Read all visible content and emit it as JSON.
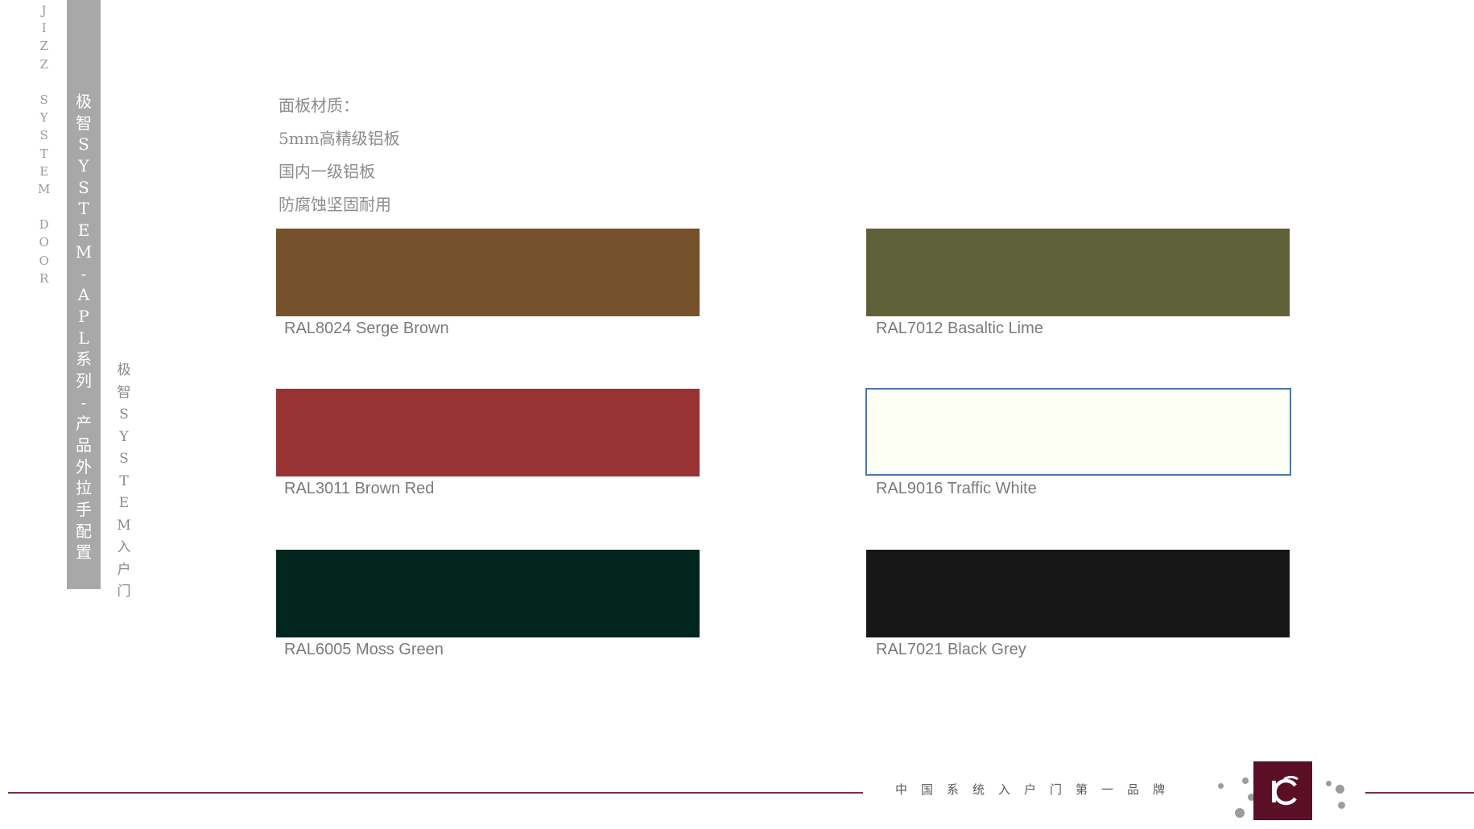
{
  "side_brand": "JIZZ SYSTEM DOOR",
  "series_title": "极智SYSTEM-APL系列-产品外拉手配置",
  "side_subtitle": "极智SYSTEM入户门",
  "material": {
    "heading": "面板材质：",
    "lines": [
      "5mm高精级铝板",
      "国内一级铝板",
      "防腐蚀坚固耐用"
    ]
  },
  "swatches": [
    {
      "name": "RAL8024 Serge Brown",
      "color": "#75522c"
    },
    {
      "name": "RAL7012 Basaltic Lime",
      "color": "#5f6138"
    },
    {
      "name": "RAL3011 Brown Red",
      "color": "#993233"
    },
    {
      "name": "RAL9016 Traffic White",
      "color": "#fefff4"
    },
    {
      "name": "RAL6005 Moss Green",
      "color": "#02261d"
    },
    {
      "name": "RAL7021 Black Grey",
      "color": "#171717"
    }
  ],
  "footer": {
    "slogan": "中国系统入户门第一品牌",
    "logo_icon": "jc-logo-icon",
    "accent_color": "#7a2f4b",
    "logo_color": "#5b0f27"
  }
}
